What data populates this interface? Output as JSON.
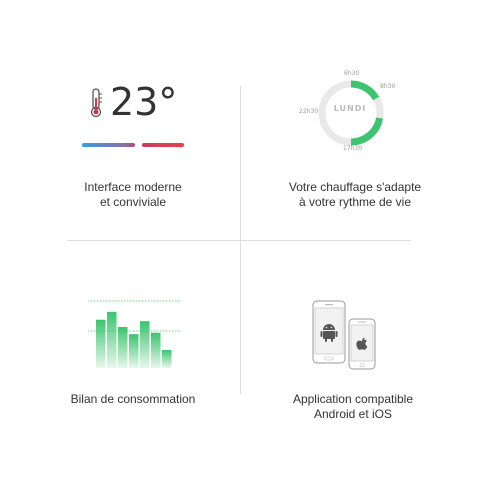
{
  "temperature": {
    "value": "23°",
    "caption": "Interface moderne\net conviviale",
    "colors": {
      "cold": "#3a9fd6",
      "hot": "#e8404a"
    }
  },
  "schedule": {
    "day": "LUNDI",
    "times": {
      "top": "6h30",
      "top_right": "8h30",
      "left": "22h30",
      "bottom": "17h30"
    },
    "caption": "Votre chauffage s'adapte\nà votre rythme de vie",
    "accent": "#3cc46e"
  },
  "consumption": {
    "caption": "Bilan de consommation",
    "bars": [
      0.67,
      0.78,
      0.57,
      0.47,
      0.65,
      0.49,
      0.25
    ],
    "accent": "#3cc46e"
  },
  "app": {
    "caption": "Application compatible\nAndroid et iOS",
    "devices": [
      "android-phone",
      "apple-phone"
    ]
  }
}
